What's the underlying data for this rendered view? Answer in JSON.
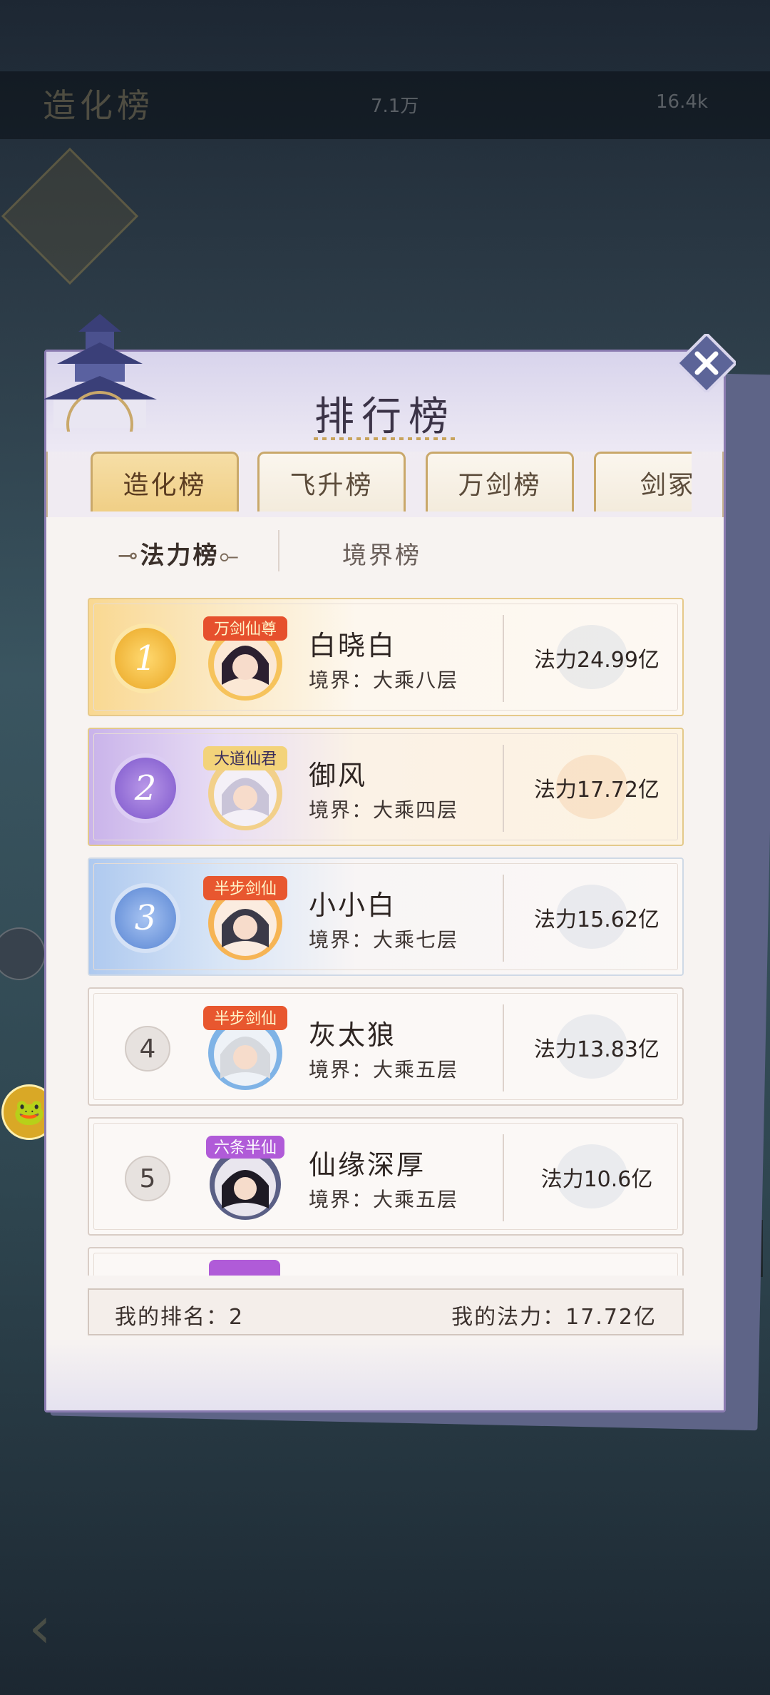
{
  "background": {
    "header_title": "造化榜",
    "stat1": "7.1万",
    "stat2": "16.4k"
  },
  "panel": {
    "title": "排行榜",
    "close_icon": "close-x-icon"
  },
  "tabs": [
    {
      "label": "造化榜",
      "active": true
    },
    {
      "label": "飞升榜",
      "active": false
    },
    {
      "label": "万剑榜",
      "active": false
    },
    {
      "label": "剑冢",
      "active": false
    }
  ],
  "subtabs": {
    "power": "法力榜",
    "realm": "境界榜"
  },
  "ranking": [
    {
      "rank": "1",
      "title_badge": "万剑仙尊",
      "name": "白晓白",
      "realm": "境界：大乘八层",
      "power": "法力24.99亿"
    },
    {
      "rank": "2",
      "title_badge": "大道仙君",
      "name": "御风",
      "realm": "境界：大乘四层",
      "power": "法力17.72亿"
    },
    {
      "rank": "3",
      "title_badge": "半步剑仙",
      "name": "小小白",
      "realm": "境界：大乘七层",
      "power": "法力15.62亿"
    },
    {
      "rank": "4",
      "title_badge": "半步剑仙",
      "name": "灰太狼",
      "realm": "境界：大乘五层",
      "power": "法力13.83亿"
    },
    {
      "rank": "5",
      "title_badge": "六条半仙",
      "name": "仙缘深厚",
      "realm": "境界：大乘五层",
      "power": "法力10.6亿"
    }
  ],
  "footer": {
    "my_rank": "我的排名：2",
    "my_power": "我的法力：17.72亿"
  },
  "colors": {
    "active_tab": "#f0cf86",
    "panel_border": "#8a7bb0",
    "gold_accent": "#c9a86a",
    "rank1": "#f0b53a",
    "rank2": "#8e69d4",
    "rank3": "#6f97dc"
  }
}
